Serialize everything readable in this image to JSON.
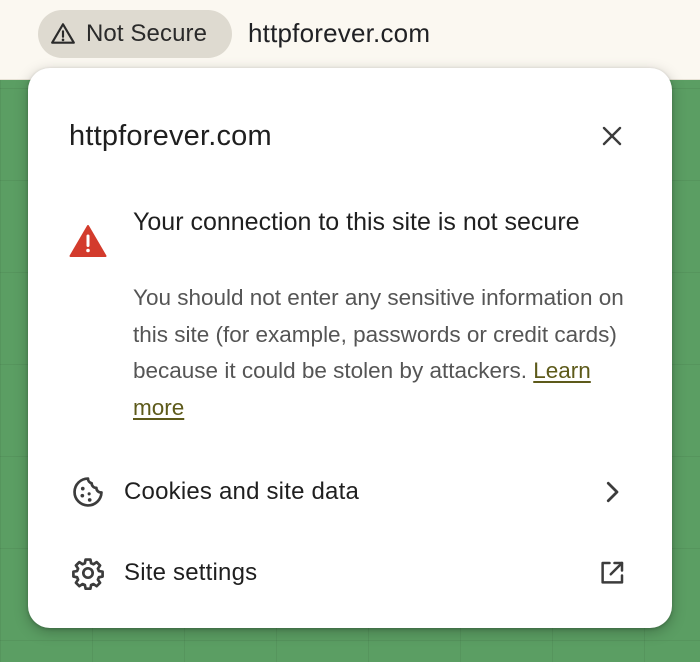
{
  "toolbar": {
    "security_chip_label": "Not Secure",
    "security_chip_icon": "warning-outline-icon",
    "url": "httpforever.com"
  },
  "popup": {
    "title": "httpforever.com",
    "close_icon": "close-icon",
    "warning": {
      "icon": "warning-filled-icon",
      "icon_color": "#d33b2c",
      "heading": "Your connection to this site is not secure",
      "body": "You should not enter any sensitive information on this site (for example, passwords or credit cards) because it could be stolen by attackers.",
      "learn_more": "Learn more",
      "learn_more_color": "#5d5a1a"
    },
    "rows": [
      {
        "label": "Cookies and site data",
        "icon": "cookie-icon",
        "trailing_icon": "chevron-right-icon"
      },
      {
        "label": "Site settings",
        "icon": "gear-icon",
        "trailing_icon": "open-in-new-icon"
      }
    ]
  },
  "colors": {
    "page_background": "#5b9e63",
    "toolbar_background": "#fbf8f1",
    "chip_background": "#dedad0",
    "popup_background": "#ffffff"
  }
}
